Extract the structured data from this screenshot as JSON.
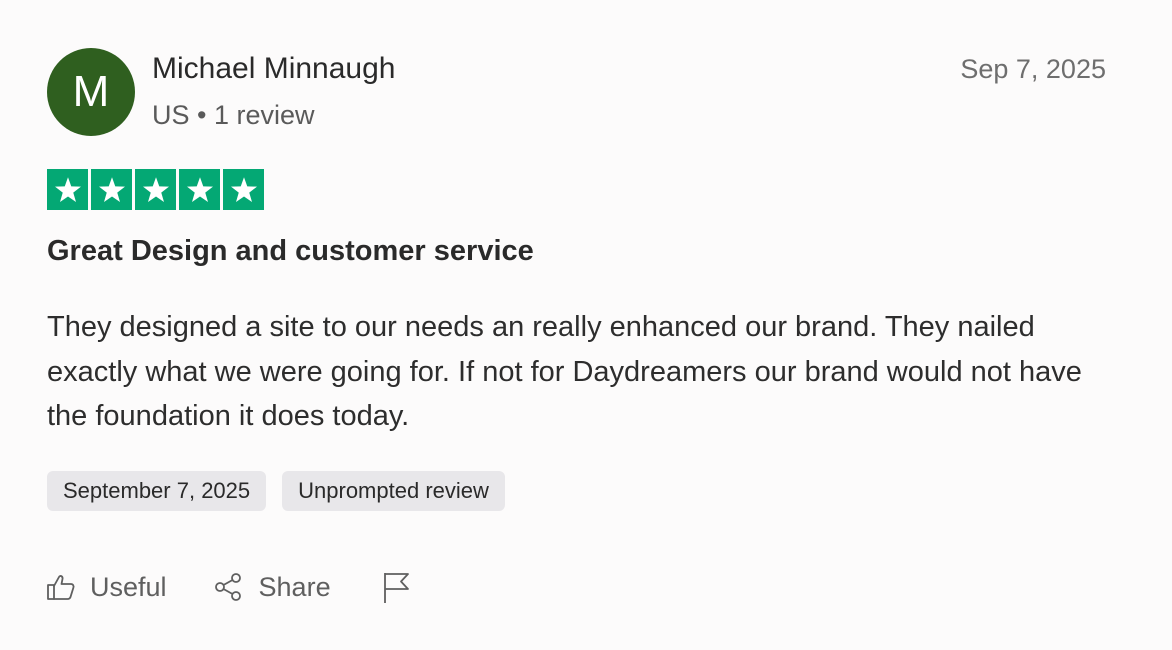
{
  "reviewer": {
    "initial": "M",
    "name": "Michael Minnaugh",
    "meta": "US • 1 review",
    "avatar_color": "#2f5f1f"
  },
  "review": {
    "date_short": "Sep 7, 2025",
    "rating": 5,
    "max_rating": 5,
    "star_color": "#04a874",
    "title": "Great Design and customer service",
    "body": "They designed a site to our needs an really enhanced our brand. They nailed exactly what we were going for. If not for Daydreamers our brand would not have the foundation it does today.",
    "tags": [
      "September 7, 2025",
      "Unprompted review"
    ]
  },
  "actions": {
    "useful_label": "Useful",
    "useful_icon": "thumbs-up-icon",
    "share_label": "Share",
    "share_icon": "share-icon",
    "flag_icon": "flag-icon"
  }
}
